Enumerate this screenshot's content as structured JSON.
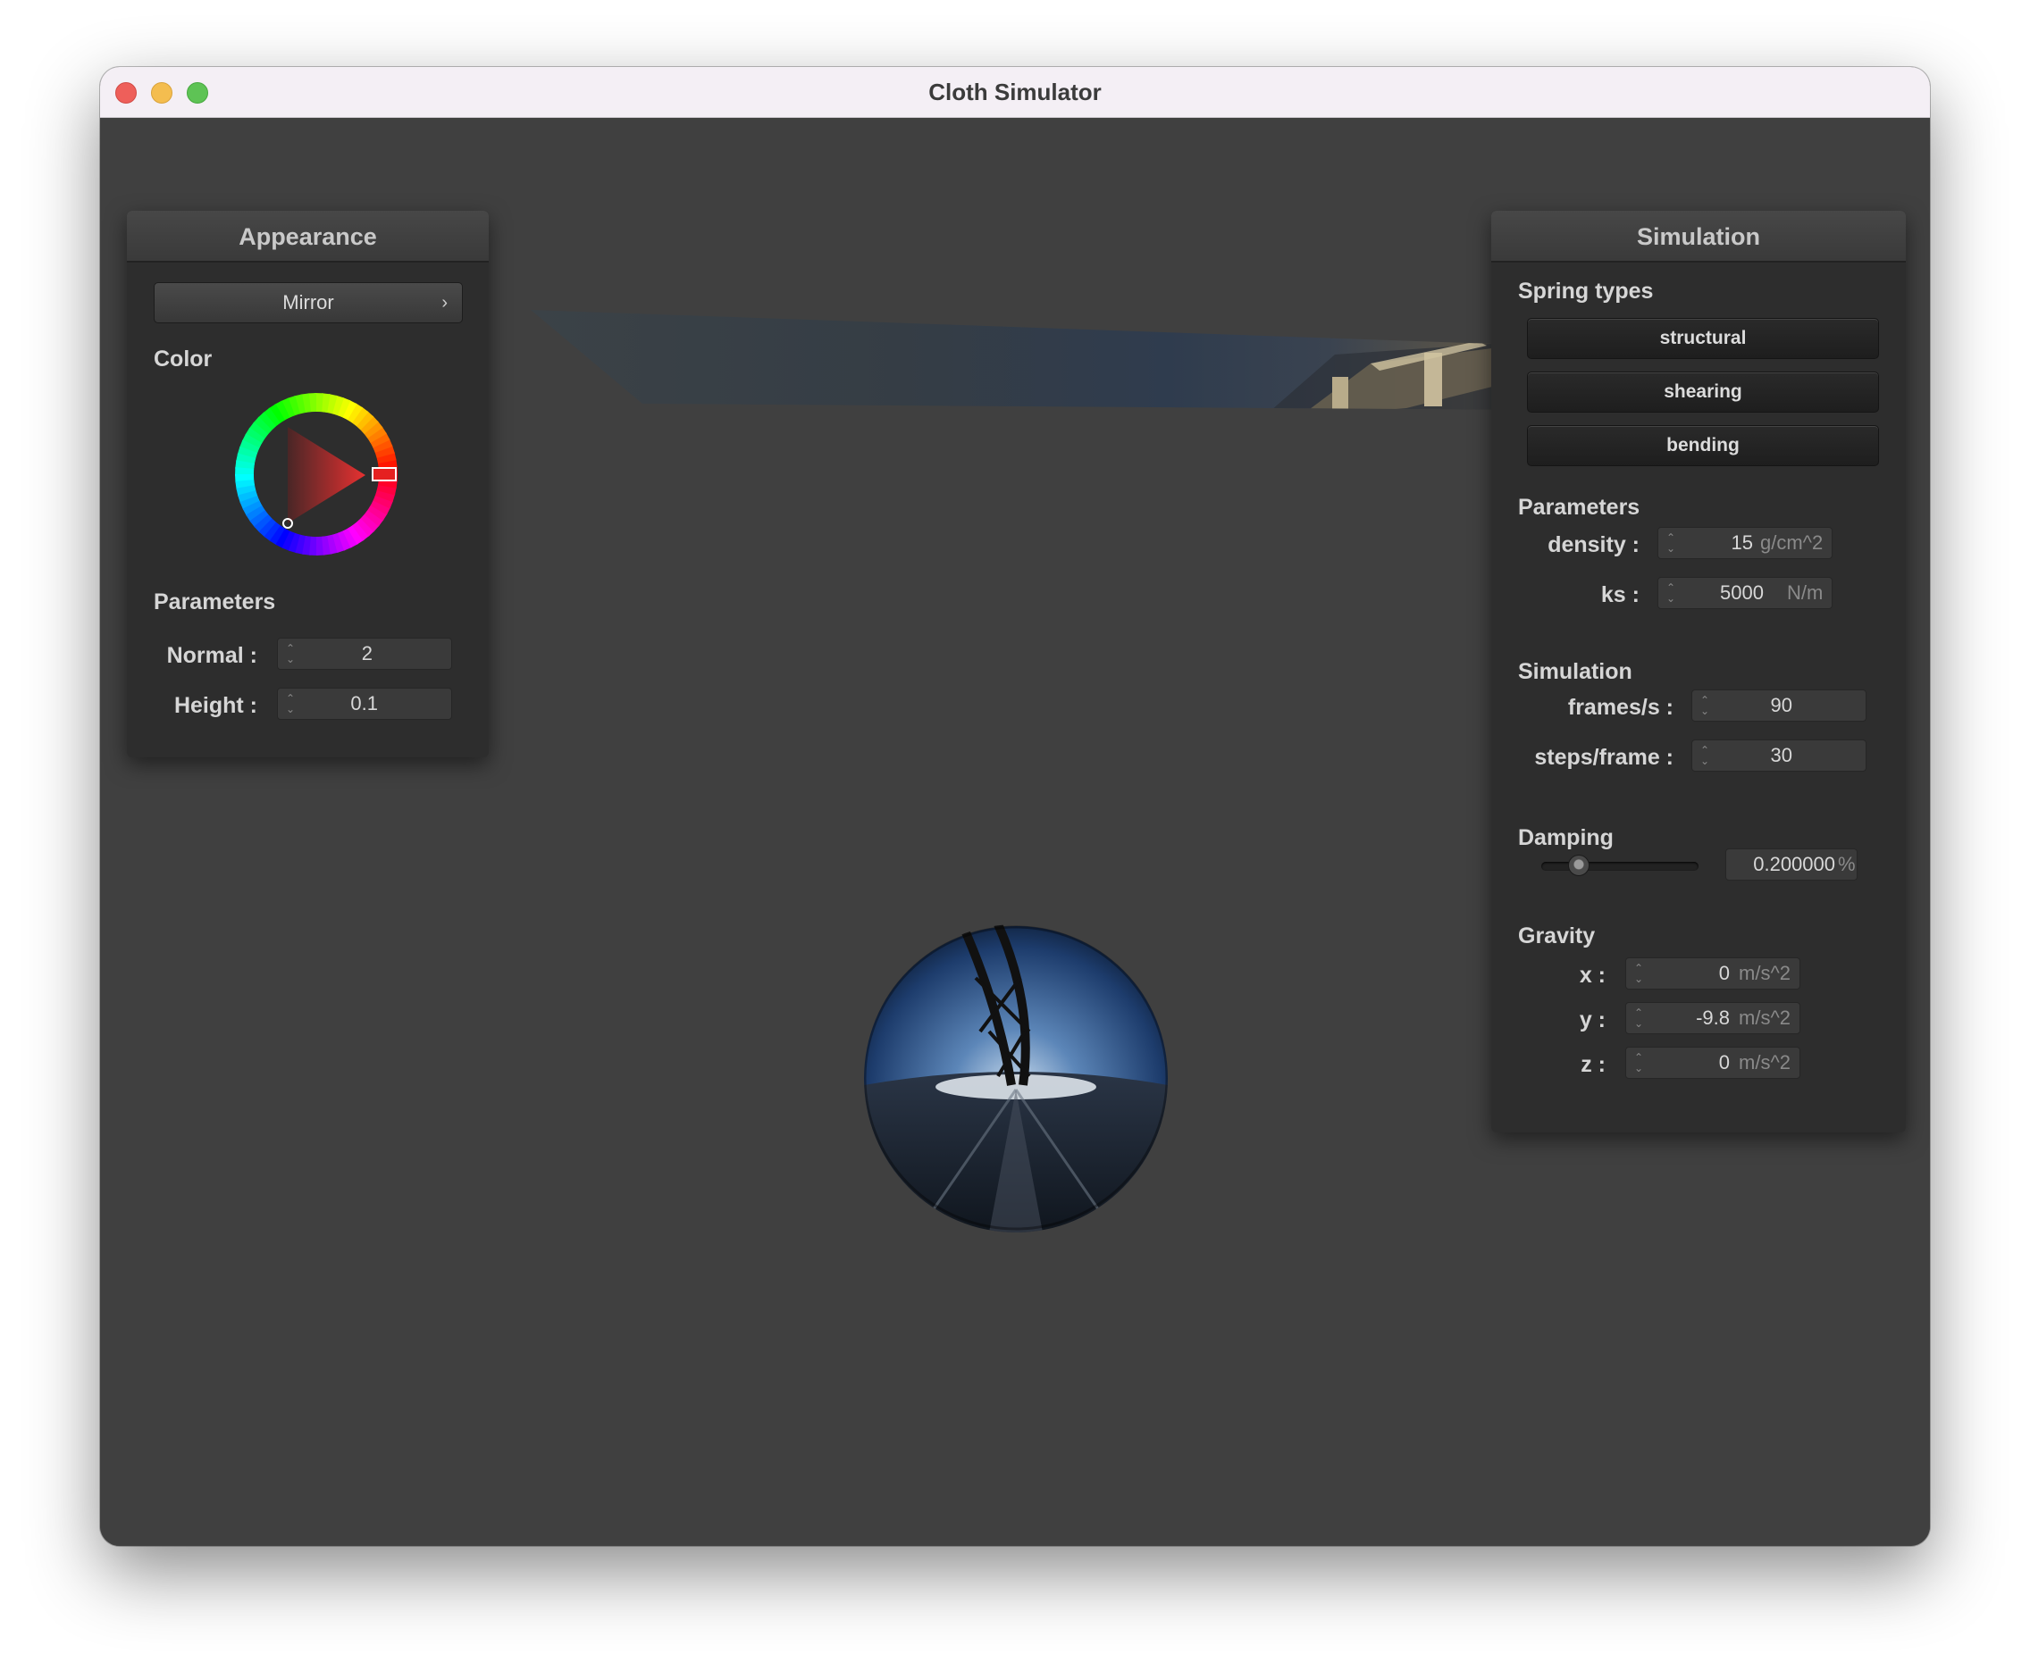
{
  "window": {
    "title": "Cloth Simulator"
  },
  "appearance": {
    "header": "Appearance",
    "shader_button": "Mirror",
    "color_label": "Color",
    "parameters_label": "Parameters",
    "normal": {
      "label": "Normal :",
      "value": "2"
    },
    "height": {
      "label": "Height :",
      "value": "0.1"
    },
    "selected_color": "#e52020"
  },
  "simulation": {
    "header": "Simulation",
    "spring_types_label": "Spring types",
    "spring_buttons": [
      "structural",
      "shearing",
      "bending"
    ],
    "parameters_label": "Parameters",
    "density": {
      "label": "density :",
      "value": "15",
      "unit": "g/cm^2"
    },
    "ks": {
      "label": "ks :",
      "value": "5000",
      "unit": "N/m"
    },
    "simulation_label": "Simulation",
    "frames": {
      "label": "frames/s :",
      "value": "90"
    },
    "steps": {
      "label": "steps/frame :",
      "value": "30"
    },
    "damping_label": "Damping",
    "damping": {
      "value": "0.200000",
      "unit": "%",
      "slider_fraction": 0.2
    },
    "gravity_label": "Gravity",
    "gravity": [
      {
        "label": "x :",
        "value": "0",
        "unit": "m/s^2"
      },
      {
        "label": "y :",
        "value": "-9.8",
        "unit": "m/s^2"
      },
      {
        "label": "z :",
        "value": "0",
        "unit": "m/s^2"
      }
    ]
  },
  "icons": {
    "close": "close-dot",
    "minimize": "minimize-dot",
    "maximize": "maximize-dot",
    "chevron": "chevron-right-icon",
    "spinner": "spinner-arrows-icon"
  }
}
